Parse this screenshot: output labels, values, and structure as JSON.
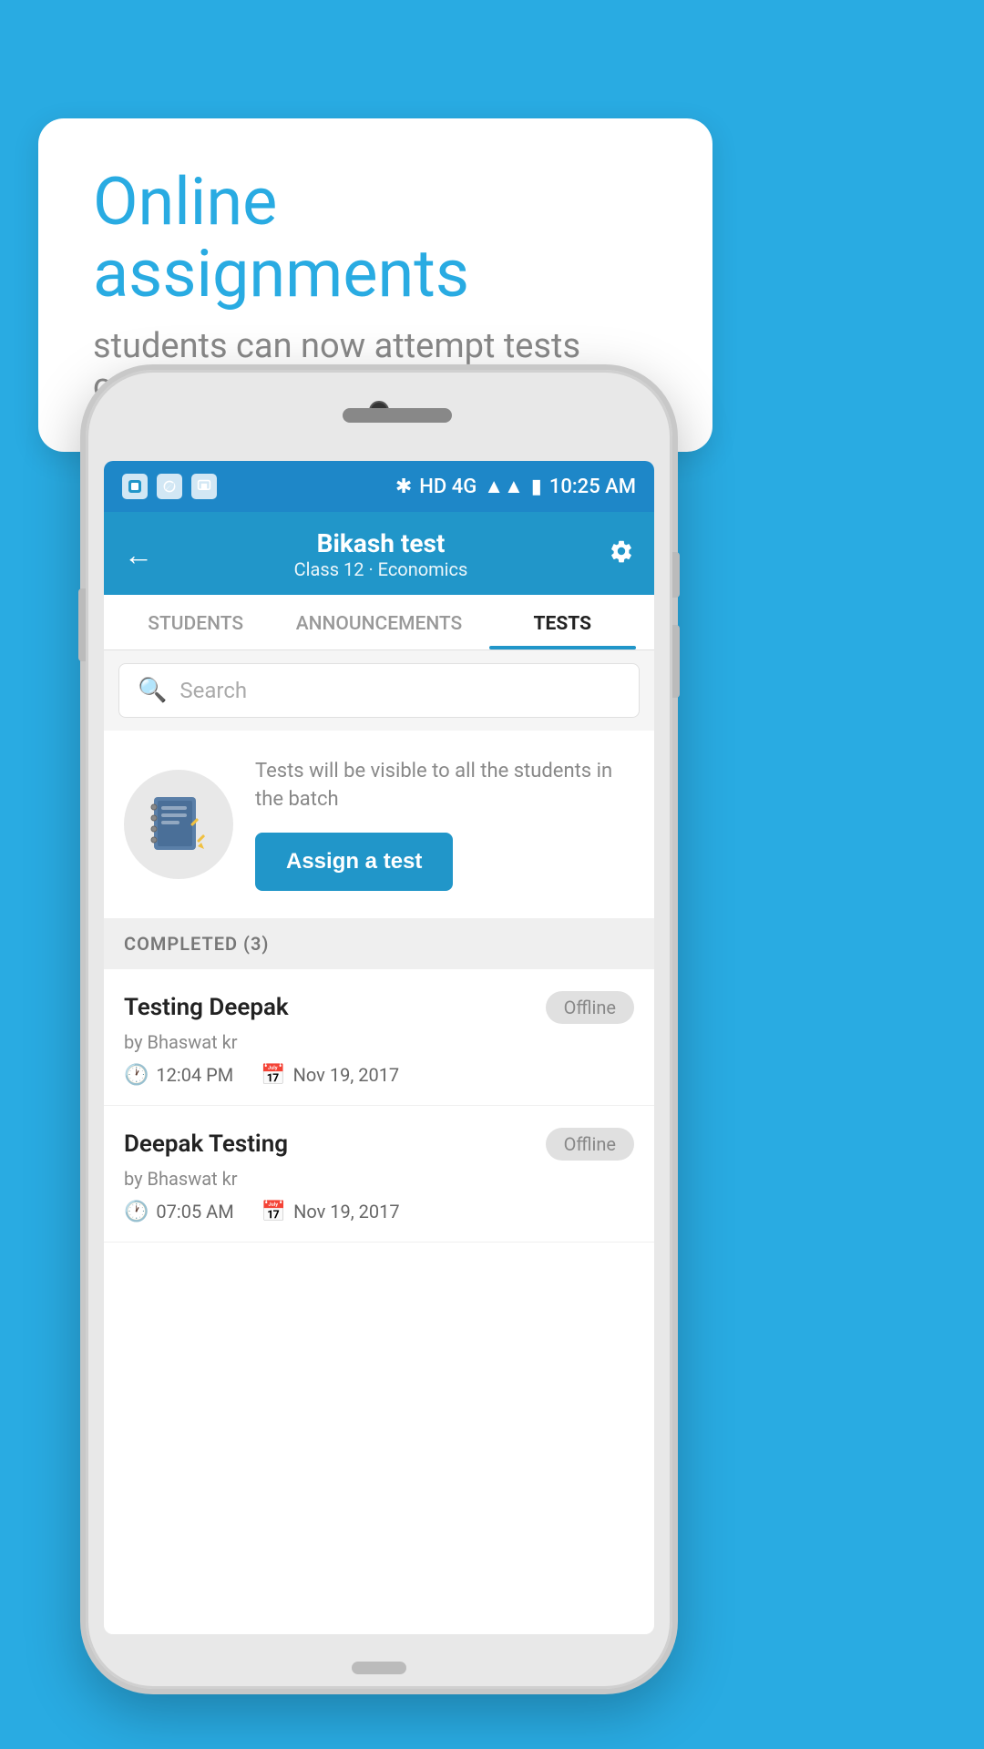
{
  "background": {
    "color": "#29abe2"
  },
  "hero": {
    "title": "Online assignments",
    "subtitle": "students can now attempt tests online"
  },
  "app": {
    "title": "Bikash test",
    "subtitle": "Class 12 · Economics",
    "back_label": "←",
    "settings_label": "⚙"
  },
  "tabs": [
    {
      "label": "STUDENTS",
      "active": false
    },
    {
      "label": "ANNOUNCEMENTS",
      "active": false
    },
    {
      "label": "TESTS",
      "active": true
    }
  ],
  "search": {
    "placeholder": "Search"
  },
  "assign_section": {
    "info_text": "Tests will be visible to all the students in the batch",
    "button_label": "Assign a test"
  },
  "completed_section": {
    "header": "COMPLETED (3)"
  },
  "tests": [
    {
      "title": "Testing Deepak",
      "author": "by Bhaswat kr",
      "time": "12:04 PM",
      "date": "Nov 19, 2017",
      "badge": "Offline"
    },
    {
      "title": "Deepak Testing",
      "author": "by Bhaswat kr",
      "time": "07:05 AM",
      "date": "Nov 19, 2017",
      "badge": "Offline"
    }
  ],
  "status_bar": {
    "time": "10:25 AM",
    "network": "HD 4G"
  }
}
